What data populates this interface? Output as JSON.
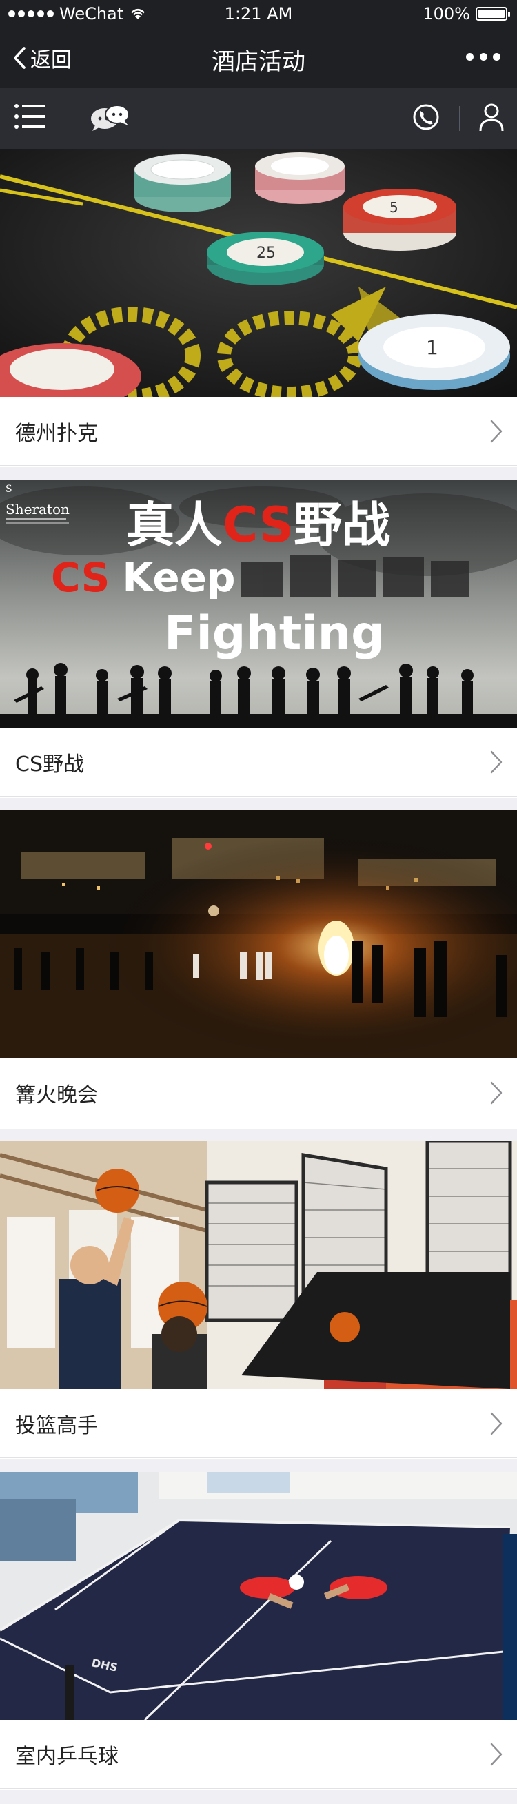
{
  "status_bar": {
    "carrier": "WeChat",
    "time": "1:21 AM",
    "battery": "100%"
  },
  "nav": {
    "back_label": "返回",
    "title": "酒店活动"
  },
  "toolbar": {
    "icons": [
      "menu-icon",
      "chat-bubbles-icon",
      "phone-icon",
      "user-icon"
    ]
  },
  "activities": [
    {
      "title": "德州扑克"
    },
    {
      "title": "CS野战"
    },
    {
      "title": "篝火晚会"
    },
    {
      "title": "投篮高手"
    },
    {
      "title": "室内乒乓球"
    }
  ],
  "cs_banner": {
    "line1_a": "真人",
    "line1_b": "CS",
    "line1_c": "野战",
    "line2_a": "CS",
    "line2_b": "Keep",
    "line3": "Fighting",
    "brand": "Sheraton"
  },
  "colors": {
    "header_bg": "#1f2023",
    "toolbar_bg": "#2b2d33",
    "page_bg": "#efeff4",
    "cs_red": "#e0241a"
  }
}
